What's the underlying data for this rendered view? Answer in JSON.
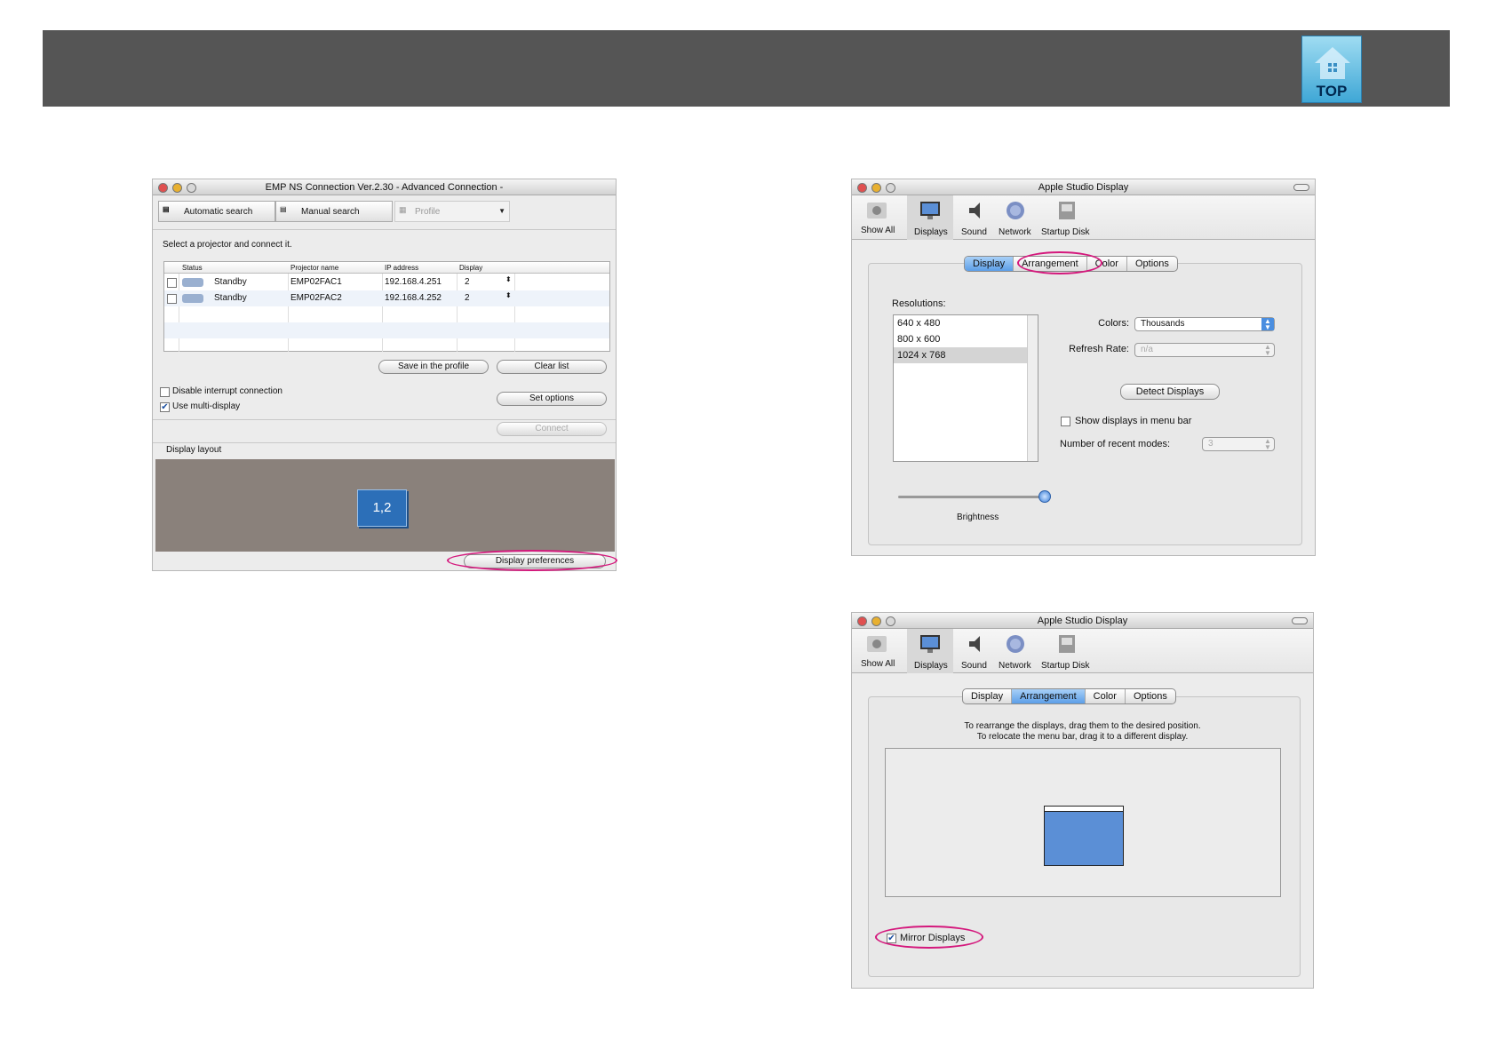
{
  "header": {
    "logo_text": "TOP"
  },
  "emp": {
    "title": "EMP NS Connection Ver.2.30 - Advanced Connection -",
    "tabs": [
      "Automatic search",
      "Manual search",
      "Profile"
    ],
    "instruction": "Select a projector and connect it.",
    "columns": [
      "Status",
      "Projector name",
      "IP address",
      "Display"
    ],
    "rows": [
      {
        "status": "Standby",
        "name": "EMP02FAC1",
        "ip": "192.168.4.251",
        "display": "2"
      },
      {
        "status": "Standby",
        "name": "EMP02FAC2",
        "ip": "192.168.4.252",
        "display": "2"
      }
    ],
    "save_profile": "Save in the profile",
    "clear_list": "Clear list",
    "disable_interrupt": "Disable interrupt connection",
    "use_multi": "Use multi-display",
    "set_options": "Set options",
    "connect": "Connect",
    "display_layout": "Display layout",
    "layout_block": "1,2",
    "display_prefs": "Display preferences"
  },
  "asd1": {
    "title": "Apple Studio Display",
    "toolbar": [
      "Show All",
      "Displays",
      "Sound",
      "Network",
      "Startup Disk"
    ],
    "tabs": [
      "Display",
      "Arrangement",
      "Color",
      "Options"
    ],
    "resolutions_label": "Resolutions:",
    "resolutions": [
      "640 x 480",
      "800 x 600",
      "1024 x 768"
    ],
    "colors_label": "Colors:",
    "colors_value": "Thousands",
    "refresh_label": "Refresh Rate:",
    "refresh_value": "n/a",
    "detect": "Detect Displays",
    "show_menu_bar": "Show displays in menu bar",
    "recent_label": "Number of recent modes:",
    "recent_value": "3",
    "brightness": "Brightness",
    "brightness_level": 1.0
  },
  "asd2": {
    "title": "Apple Studio Display",
    "toolbar": [
      "Show All",
      "Displays",
      "Sound",
      "Network",
      "Startup Disk"
    ],
    "tabs": [
      "Display",
      "Arrangement",
      "Color",
      "Options"
    ],
    "instruction1": "To rearrange the displays, drag them to the desired position.",
    "instruction2": "To relocate the menu bar, drag it to a different display.",
    "mirror": "Mirror Displays"
  },
  "colors": {
    "accent": "#d4187c",
    "header_bg": "#555555",
    "layout_bg": "#8a817b",
    "display_blue": "#5b8fd6"
  }
}
